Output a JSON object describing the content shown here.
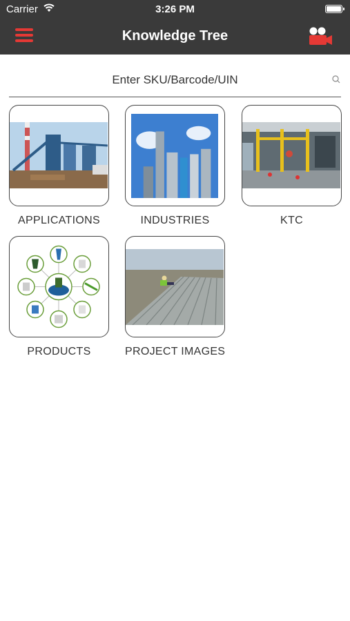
{
  "status_bar": {
    "carrier": "Carrier",
    "time": "3:26 PM"
  },
  "header": {
    "title": "Knowledge Tree",
    "menu_icon": "hamburger-menu-icon",
    "camera_icon": "video-camera-icon"
  },
  "search": {
    "placeholder": "Enter SKU/Barcode/UIN",
    "icon": "search-icon"
  },
  "categories": [
    {
      "label": "APPLICATIONS"
    },
    {
      "label": "INDUSTRIES"
    },
    {
      "label": "KTC"
    },
    {
      "label": "PRODUCTS"
    },
    {
      "label": "PROJECT IMAGES"
    }
  ],
  "colors": {
    "bar": "#3a3a3a",
    "accent": "#e53935"
  }
}
